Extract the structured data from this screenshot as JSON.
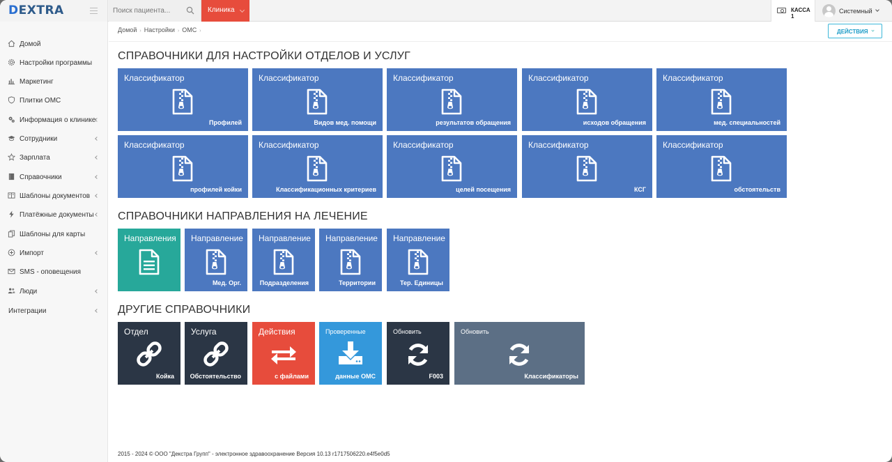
{
  "header": {
    "logo_text": "EXTRA",
    "logo_letter": "D",
    "search_placeholder": "Поиск пациента...",
    "clinic_label": "Клиника",
    "kassa_label": "КАССА 1",
    "user_name": "Системный"
  },
  "sidebar": {
    "items": [
      {
        "label": "Домой",
        "icon": "home-icon",
        "chevron": false
      },
      {
        "label": "Настройки программы",
        "icon": "gear-icon",
        "chevron": false
      },
      {
        "label": "Маркетинг",
        "icon": "bar-chart-icon",
        "chevron": false
      },
      {
        "label": "Плитки ОМС",
        "icon": "shield-icon",
        "chevron": false
      },
      {
        "label": "Информация о клинике",
        "icon": "gears-icon",
        "chevron": true
      },
      {
        "label": "Сотрудники",
        "icon": "graduation-cap-icon",
        "chevron": true
      },
      {
        "label": "Зарплата",
        "icon": "star-icon",
        "chevron": true
      },
      {
        "label": "Справочники",
        "icon": "book-icon",
        "chevron": true
      },
      {
        "label": "Шаблоны документов",
        "icon": "columns-icon",
        "chevron": true
      },
      {
        "label": "Платёжные документы",
        "icon": "bolt-icon",
        "chevron": true
      },
      {
        "label": "Шаблоны для карты",
        "icon": "copy-icon",
        "chevron": false
      },
      {
        "label": "Импорт",
        "icon": "plus-circle-icon",
        "chevron": true
      },
      {
        "label": "SMS - оповещения",
        "icon": "envelope-icon",
        "chevron": false
      },
      {
        "label": "Люди",
        "icon": "users-icon",
        "chevron": true
      },
      {
        "label": "Интеграции",
        "icon": "",
        "chevron": true
      }
    ]
  },
  "breadcrumb": [
    "Домой",
    "Настройки",
    "ОМС"
  ],
  "actions_label": "ДЕЙСТВИЯ",
  "sections": {
    "s1": "СПРАВОЧНИКИ ДЛЯ НАСТРОЙКИ ОТДЕЛОВ И УСЛУГ",
    "s2": "СПРАВОЧНИКИ НАПРАВЛЕНИЯ НА ЛЕЧЕНИЕ",
    "s3": "ДРУГИЕ СПРАВОЧНИКИ"
  },
  "tiles_row1": [
    {
      "title": "Классификатор",
      "sub": "Профилей"
    },
    {
      "title": "Классификатор",
      "sub": "Видов мед. помощи"
    },
    {
      "title": "Классификатор",
      "sub": "результатов обращения"
    },
    {
      "title": "Классификатор",
      "sub": "исходов обращения"
    },
    {
      "title": "Классификатор",
      "sub": "мед. специальностей"
    }
  ],
  "tiles_row2": [
    {
      "title": "Классификатор",
      "sub": "профилей койки"
    },
    {
      "title": "Классификатор",
      "sub": "Классификационных критериев"
    },
    {
      "title": "Классификатор",
      "sub": "целей посещения"
    },
    {
      "title": "Классификатор",
      "sub": "КСГ"
    },
    {
      "title": "Классификатор",
      "sub": "обстоятельств"
    }
  ],
  "tiles_row3": [
    {
      "title": "Направления",
      "sub": "",
      "color": "#27a89a",
      "icon": "document-icon"
    },
    {
      "title": "Направление",
      "sub": "Мед. Орг.",
      "color": "#4c78c0",
      "icon": "zip-file-icon"
    },
    {
      "title": "Направление",
      "sub": "Подразделения",
      "color": "#4c78c0",
      "icon": "zip-file-icon"
    },
    {
      "title": "Направление",
      "sub": "Территории",
      "color": "#4c78c0",
      "icon": "zip-file-icon"
    },
    {
      "title": "Направление",
      "sub": "Тер. Единицы",
      "color": "#4c78c0",
      "icon": "zip-file-icon"
    }
  ],
  "tiles_row4": [
    {
      "title": "Отдел",
      "sub": "Койка",
      "color": "#2b3645",
      "icon": "link-icon"
    },
    {
      "title": "Услуга",
      "sub": "Обстоятельство",
      "color": "#2b3645",
      "icon": "link-icon"
    },
    {
      "title": "Действия",
      "sub": "с файлами",
      "color": "#e74c3c",
      "icon": "exchange-icon"
    },
    {
      "title": "Проверенные",
      "sub": "данные ОМС",
      "color": "#3498db",
      "icon": "download-icon"
    },
    {
      "title": "Обновить",
      "sub": "F003",
      "color": "#2b3645",
      "icon": "refresh-icon"
    },
    {
      "title": "Обновить",
      "sub": "Классификаторы",
      "color": "#5c6f85",
      "icon": "refresh-icon"
    }
  ],
  "footer": "2015 - 2024 © ООО \"Декстра Групп\" - электронное здравоохранение Версия 10.13 r1717506220.e4f5e0d5"
}
